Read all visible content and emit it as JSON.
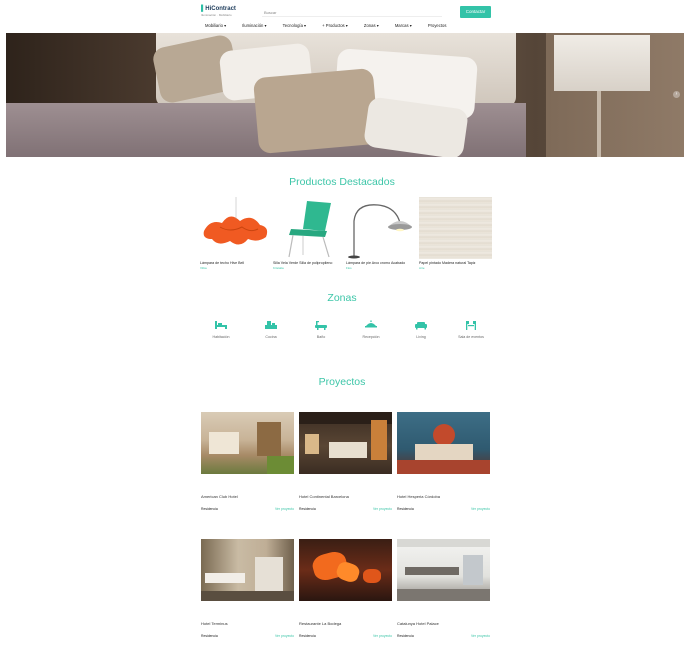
{
  "header": {
    "logo_main": "HiContract",
    "logo_sub": "Iluminación · Mobiliario",
    "search_placeholder": "Buscar",
    "contact_label": "Contactar",
    "nav": [
      "Mobiliario ▾",
      "Iluminación ▾",
      "Tecnología ▾",
      "+ Productos ▾",
      "Zonas ▾",
      "Marcas ▾",
      "Proyectos"
    ]
  },
  "sections": {
    "featured_title": "Productos Destacados",
    "zones_title": "Zonas",
    "projects_title": "Proyectos"
  },
  "products": [
    {
      "name": "Lámpara de techo Hive Bell",
      "brand": "Vibia"
    },
    {
      "name": "Silla Vela Verde Silla de polipropileno",
      "brand": "Kristalia"
    },
    {
      "name": "Lámpara de pie Arco cromo Acabado",
      "brand": "Flos"
    },
    {
      "name": "Papel pintado Madera natural Tapiz",
      "brand": "Arte"
    }
  ],
  "zones": [
    {
      "label": "Habitación",
      "icon": "bed-icon"
    },
    {
      "label": "Cocina",
      "icon": "kitchen-icon"
    },
    {
      "label": "Baño",
      "icon": "bath-icon"
    },
    {
      "label": "Recepción",
      "icon": "reception-icon"
    },
    {
      "label": "Living",
      "icon": "sofa-icon"
    },
    {
      "label": "Sala de eventos",
      "icon": "event-hall-icon"
    }
  ],
  "projects": [
    {
      "name": "American Club Hotel",
      "zone": "Residencia",
      "more": "Ver proyecto"
    },
    {
      "name": "Hotel Continental Barcelona",
      "zone": "Residencia",
      "more": "Ver proyecto"
    },
    {
      "name": "Hotel Hesperia Córdoba",
      "zone": "Residencia",
      "more": "Ver proyecto"
    },
    {
      "name": "Hotel Terminus",
      "zone": "Residencia",
      "more": "Ver proyecto"
    },
    {
      "name": "Restaurante La Bodega",
      "zone": "Residencia",
      "more": "Ver proyecto"
    },
    {
      "name": "Catalunya Hotel Palace",
      "zone": "Residencia",
      "more": "Ver proyecto"
    }
  ],
  "colors": {
    "accent": "#33c3a8",
    "text": "#333333"
  }
}
